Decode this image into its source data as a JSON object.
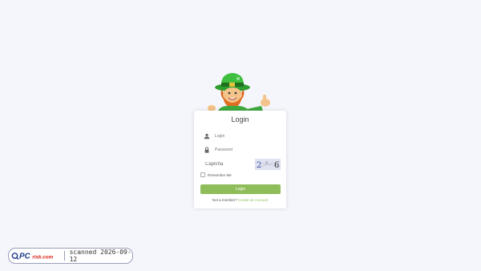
{
  "login_card": {
    "title": "Login",
    "login_placeholder": "Login",
    "password_placeholder": "Password",
    "captcha_placeholder": "Captcha",
    "captcha_text": "2 * 6",
    "remember_label": "Remember Me",
    "submit_label": "Login",
    "signup_prompt": "Not a member?",
    "signup_link": "Create an Account"
  },
  "watermark": {
    "brand": "PCrisk.com",
    "scan_text": "scanned 2026-09-12"
  },
  "colors": {
    "accent": "#8fbd5a",
    "background": "#f5f6fb",
    "card": "#ffffff"
  },
  "icons": {
    "login_field": "user-icon",
    "password_field": "lock-icon",
    "mascot": "leprechaun-mascot",
    "brand_logo": "pcrisk-logo"
  }
}
